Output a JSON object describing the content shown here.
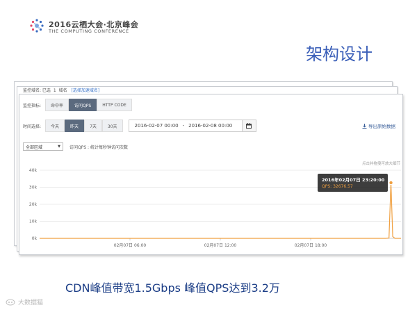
{
  "header": {
    "conference_line1": "2016云栖大会·北京峰会",
    "conference_line2": "THE COMPUTING CONFERENCE",
    "slide_title": "架构设计"
  },
  "console": {
    "domain_label": "监控域名: 已选",
    "domain_count": "1",
    "domain_unit": "域名",
    "domain_link": "[选择加速域名]",
    "metric_label": "监控指标:",
    "metric_tabs": [
      "命中率",
      "访问QPS",
      "HTTP CODE"
    ],
    "metric_active": 1,
    "time_label": "时间选择:",
    "time_tabs": [
      "今天",
      "昨天",
      "7天",
      "30天"
    ],
    "time_active": 1,
    "date_start": "2016-02-07 00:00",
    "date_sep": "-",
    "date_end": "2016-02-08 00:00",
    "calendar_icon": "calendar-icon",
    "export_label": "导出原始数据",
    "export_icon": "download-icon",
    "region_select": "全部区域",
    "qps_desc": "访问QPS : 统计每秒钟访问次数",
    "drill_hint": "点击并拖曳可放大细节"
  },
  "tooltip": {
    "time": "2016年02月07日 23:20:00",
    "value": "QPS: 32676.57"
  },
  "chart_data": {
    "type": "line",
    "series": [
      {
        "values": [
          [
            0,
            0
          ],
          [
            23.0,
            0
          ],
          [
            23.2,
            200
          ],
          [
            23.333,
            32676.57
          ],
          [
            23.45,
            1000
          ],
          [
            23.6,
            0
          ],
          [
            24,
            0
          ]
        ]
      }
    ],
    "y_ticks": [
      "0k",
      "10k",
      "20k",
      "30k",
      "40k"
    ],
    "ylim": [
      0,
      40000
    ],
    "x_ticks": [
      "02月07日 06:00",
      "02月07日 12:00",
      "02月07日 18:00"
    ],
    "x_tick_hours": [
      6,
      12,
      18
    ],
    "xlim": [
      0,
      24
    ],
    "color": "#f0a040",
    "grid": true
  },
  "caption": "CDN峰值带宽1.5Gbps 峰值QPS达到3.2万",
  "watermark": "大数据猫"
}
